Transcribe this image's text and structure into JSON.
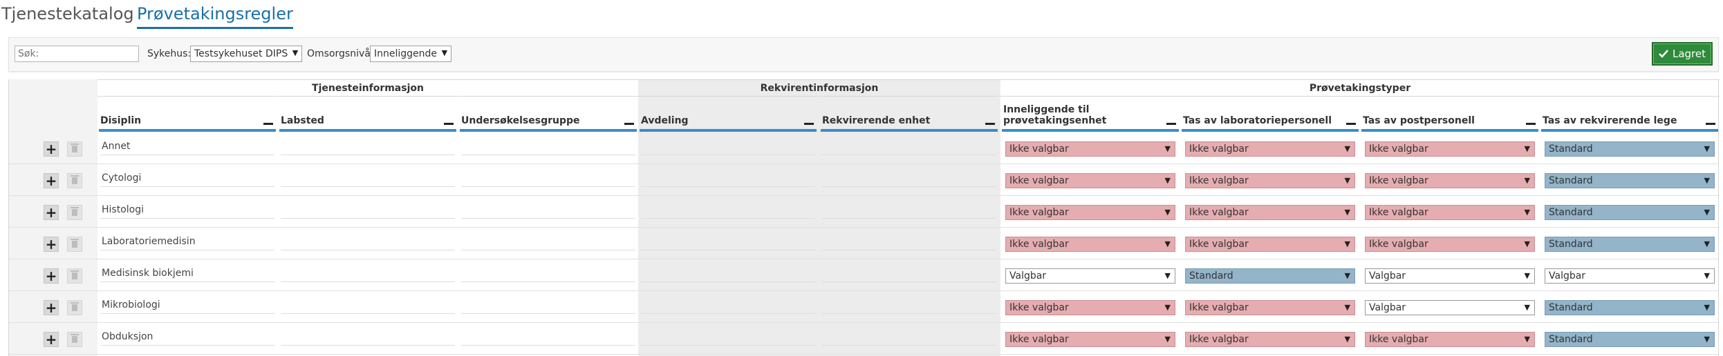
{
  "tabs": [
    {
      "label": "Tjenestekatalog"
    },
    {
      "label": "Prøvetakingsregler"
    }
  ],
  "filter": {
    "search_placeholder": "Søk:",
    "hospital_label": "Sykehus:",
    "hospital_value": "Testsykehuset DIPS",
    "care_level_label": "Omsorgsnivå",
    "care_level_value": "Inneliggende",
    "save_label": "Lagret"
  },
  "groups": [
    "Tjenesteinformasjon",
    "Rekvirentinformasjon",
    "Prøvetakingstyper"
  ],
  "columns": [
    "Disiplin",
    "Labsted",
    "Undersøkelsesgruppe",
    "Avdeling",
    "Rekvirerende enhet",
    "Inneliggende til prøvetakingsenhet",
    "Tas av laboratoriepersonell",
    "Tas av postpersonell",
    "Tas av rekvirerende lege"
  ],
  "rows": [
    {
      "disiplin": "Annet",
      "types": [
        "Ikke valgbar",
        "Ikke valgbar",
        "Ikke valgbar",
        "Standard"
      ]
    },
    {
      "disiplin": "Cytologi",
      "types": [
        "Ikke valgbar",
        "Ikke valgbar",
        "Ikke valgbar",
        "Standard"
      ]
    },
    {
      "disiplin": "Histologi",
      "types": [
        "Ikke valgbar",
        "Ikke valgbar",
        "Ikke valgbar",
        "Standard"
      ]
    },
    {
      "disiplin": "Laboratoriemedisin",
      "types": [
        "Ikke valgbar",
        "Ikke valgbar",
        "Ikke valgbar",
        "Standard"
      ]
    },
    {
      "disiplin": "Medisinsk biokjemi",
      "types": [
        "Valgbar",
        "Standard",
        "Valgbar",
        "Valgbar"
      ]
    },
    {
      "disiplin": "Mikrobiologi",
      "types": [
        "Ikke valgbar",
        "Ikke valgbar",
        "Valgbar",
        "Standard"
      ]
    },
    {
      "disiplin": "Obduksjon",
      "types": [
        "Ikke valgbar",
        "Ikke valgbar",
        "Ikke valgbar",
        "Standard"
      ]
    }
  ],
  "colors": {
    "ikke_valgbar": "#e6adb0",
    "standard": "#93b4c9",
    "valgbar": "#ffffff",
    "accent": "#1a6fa8",
    "save": "#2e8b3a"
  },
  "icons": {
    "add": "plus-icon",
    "delete": "trash-icon",
    "collapse": "minus-icon",
    "dropdown": "caret-down-icon",
    "save": "check-icon"
  }
}
